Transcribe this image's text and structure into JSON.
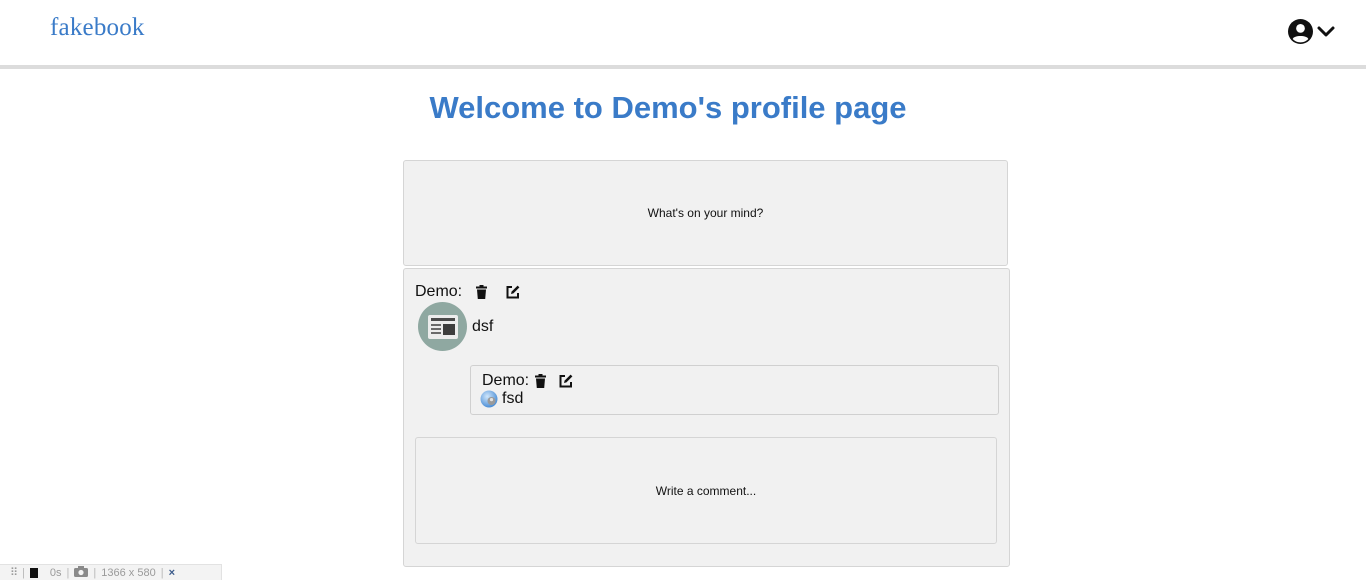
{
  "navbar": {
    "logo": "fakebook",
    "user_icon": "user-circle-icon",
    "menu_icon": "chevron-down-icon"
  },
  "page": {
    "title": "Welcome to Demo's profile page"
  },
  "composer": {
    "placeholder": "What's on your mind?"
  },
  "post": {
    "author": "Demo:",
    "text": "dsf",
    "delete_icon": "trash-icon",
    "edit_icon": "edit-icon",
    "comments": [
      {
        "author": "Demo:",
        "text": "fsd"
      }
    ],
    "comment_placeholder": "Write a comment..."
  },
  "devbar": {
    "timer": "0s",
    "size": "1366 x 580",
    "close": "×"
  },
  "colors": {
    "brand": "#3a7bc8",
    "card_bg": "#f1f1f1",
    "avatar_bg": "#8fa8a1"
  }
}
